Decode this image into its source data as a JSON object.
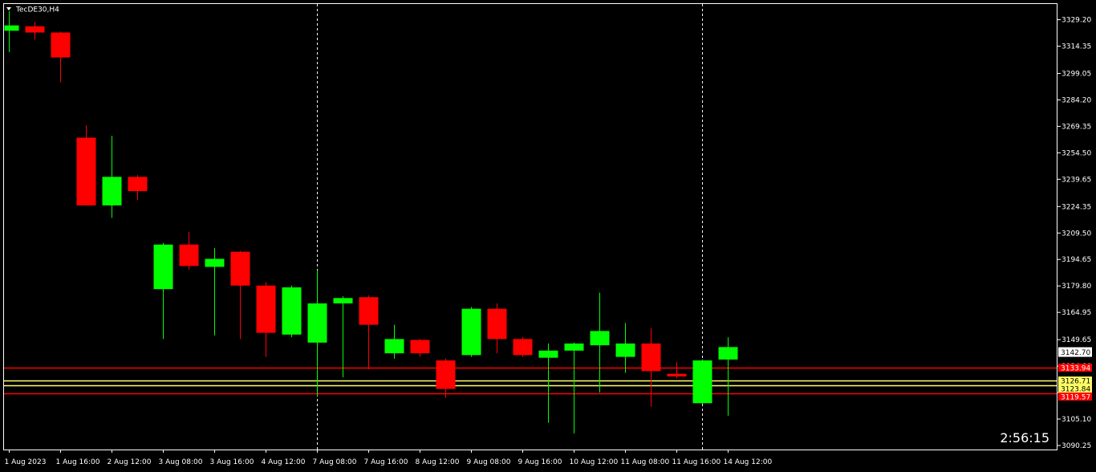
{
  "window": {
    "title": "TecDE30,H4"
  },
  "timer": {
    "countdown": "2:56:15"
  },
  "colors": {
    "background": "#000000",
    "frame": "#ffffff",
    "bull": "#00ff00",
    "bear": "#ff0000",
    "resistance_line": "#ff0000",
    "support_line": "#ffff66",
    "separator": "#ffffff"
  },
  "chart_data": {
    "type": "candlestick",
    "symbol": "TecDE30",
    "timeframe": "H4",
    "ylim": [
      3088.0,
      3338.0
    ],
    "y_ticks": [
      "3329.20",
      "3314.35",
      "3299.05",
      "3284.20",
      "3269.35",
      "3254.50",
      "3239.65",
      "3224.35",
      "3209.50",
      "3194.65",
      "3179.80",
      "3164.95",
      "3149.65",
      "3134.80",
      "3119.95",
      "3105.10",
      "3090.25"
    ],
    "x_ticks": [
      {
        "index": 0,
        "label": "1 Aug 2023"
      },
      {
        "index": 2,
        "label": "1 Aug 16:00"
      },
      {
        "index": 4,
        "label": "2 Aug 12:00"
      },
      {
        "index": 6,
        "label": "3 Aug 08:00"
      },
      {
        "index": 8,
        "label": "3 Aug 16:00"
      },
      {
        "index": 10,
        "label": "4 Aug 12:00"
      },
      {
        "index": 12,
        "label": "7 Aug 08:00"
      },
      {
        "index": 14,
        "label": "7 Aug 16:00"
      },
      {
        "index": 16,
        "label": "8 Aug 12:00"
      },
      {
        "index": 18,
        "label": "9 Aug 08:00"
      },
      {
        "index": 20,
        "label": "9 Aug 16:00"
      },
      {
        "index": 22,
        "label": "10 Aug 12:00"
      },
      {
        "index": 24,
        "label": "11 Aug 08:00"
      },
      {
        "index": 26,
        "label": "11 Aug 16:00"
      },
      {
        "index": 28,
        "label": "14 Aug 12:00"
      }
    ],
    "candles": [
      {
        "o": 3323.0,
        "h": 3334.0,
        "l": 3311.0,
        "c": 3326.0
      },
      {
        "o": 3325.5,
        "h": 3328.0,
        "l": 3318.0,
        "c": 3322.0
      },
      {
        "o": 3322.0,
        "h": 3322.5,
        "l": 3294.0,
        "c": 3308.0
      },
      {
        "o": 3263.0,
        "h": 3270.0,
        "l": 3232.0,
        "c": 3225.0
      },
      {
        "o": 3225.0,
        "h": 3264.0,
        "l": 3218.0,
        "c": 3241.0
      },
      {
        "o": 3241.0,
        "h": 3242.0,
        "l": 3228.0,
        "c": 3233.0
      },
      {
        "o": 3178.0,
        "h": 3204.0,
        "l": 3150.0,
        "c": 3203.0
      },
      {
        "o": 3203.0,
        "h": 3210.0,
        "l": 3189.0,
        "c": 3191.0
      },
      {
        "o": 3190.5,
        "h": 3201.0,
        "l": 3152.0,
        "c": 3195.0
      },
      {
        "o": 3199.0,
        "h": 3199.5,
        "l": 3150.0,
        "c": 3180.0
      },
      {
        "o": 3180.0,
        "h": 3182.0,
        "l": 3140.0,
        "c": 3153.5
      },
      {
        "o": 3152.5,
        "h": 3180.0,
        "l": 3151.0,
        "c": 3179.0
      },
      {
        "o": 3148.0,
        "h": 3188.5,
        "l": 3118.0,
        "c": 3170.0
      },
      {
        "o": 3170.0,
        "h": 3174.0,
        "l": 3128.5,
        "c": 3173.0
      },
      {
        "o": 3173.5,
        "h": 3174.5,
        "l": 3133.0,
        "c": 3158.0
      },
      {
        "o": 3142.0,
        "h": 3158.0,
        "l": 3139.0,
        "c": 3150.0
      },
      {
        "o": 3149.5,
        "h": 3150.0,
        "l": 3140.0,
        "c": 3142.0
      },
      {
        "o": 3138.0,
        "h": 3139.0,
        "l": 3117.0,
        "c": 3122.0
      },
      {
        "o": 3141.0,
        "h": 3168.0,
        "l": 3140.0,
        "c": 3167.0
      },
      {
        "o": 3167.0,
        "h": 3170.0,
        "l": 3142.0,
        "c": 3150.0
      },
      {
        "o": 3150.0,
        "h": 3151.0,
        "l": 3140.0,
        "c": 3141.0
      },
      {
        "o": 3139.5,
        "h": 3147.5,
        "l": 3103.0,
        "c": 3143.5
      },
      {
        "o": 3143.5,
        "h": 3148.0,
        "l": 3097.0,
        "c": 3147.5
      },
      {
        "o": 3146.5,
        "h": 3176.0,
        "l": 3120.0,
        "c": 3154.5
      },
      {
        "o": 3140.0,
        "h": 3159.0,
        "l": 3131.0,
        "c": 3147.5
      },
      {
        "o": 3147.5,
        "h": 3156.0,
        "l": 3112.0,
        "c": 3132.0
      },
      {
        "o": 3130.5,
        "h": 3137.0,
        "l": 3128.0,
        "c": 3129.0
      },
      {
        "o": 3114.0,
        "h": 3138.5,
        "l": 3113.5,
        "c": 3138.0
      },
      {
        "o": 3138.5,
        "h": 3151.0,
        "l": 3107.0,
        "c": 3145.5
      }
    ],
    "session_separators": [
      12,
      27
    ],
    "horizontal_lines": [
      {
        "price": 3133.94,
        "label": "3133.94",
        "kind": "resistance"
      },
      {
        "price": 3126.71,
        "label": "3126.71",
        "kind": "support"
      },
      {
        "price": 3123.84,
        "label": "3123.84",
        "kind": "support"
      },
      {
        "price": 3119.57,
        "label": "3119.57",
        "kind": "resistance"
      }
    ],
    "current_price": {
      "price": 3142.7,
      "label": "3142.70"
    }
  }
}
